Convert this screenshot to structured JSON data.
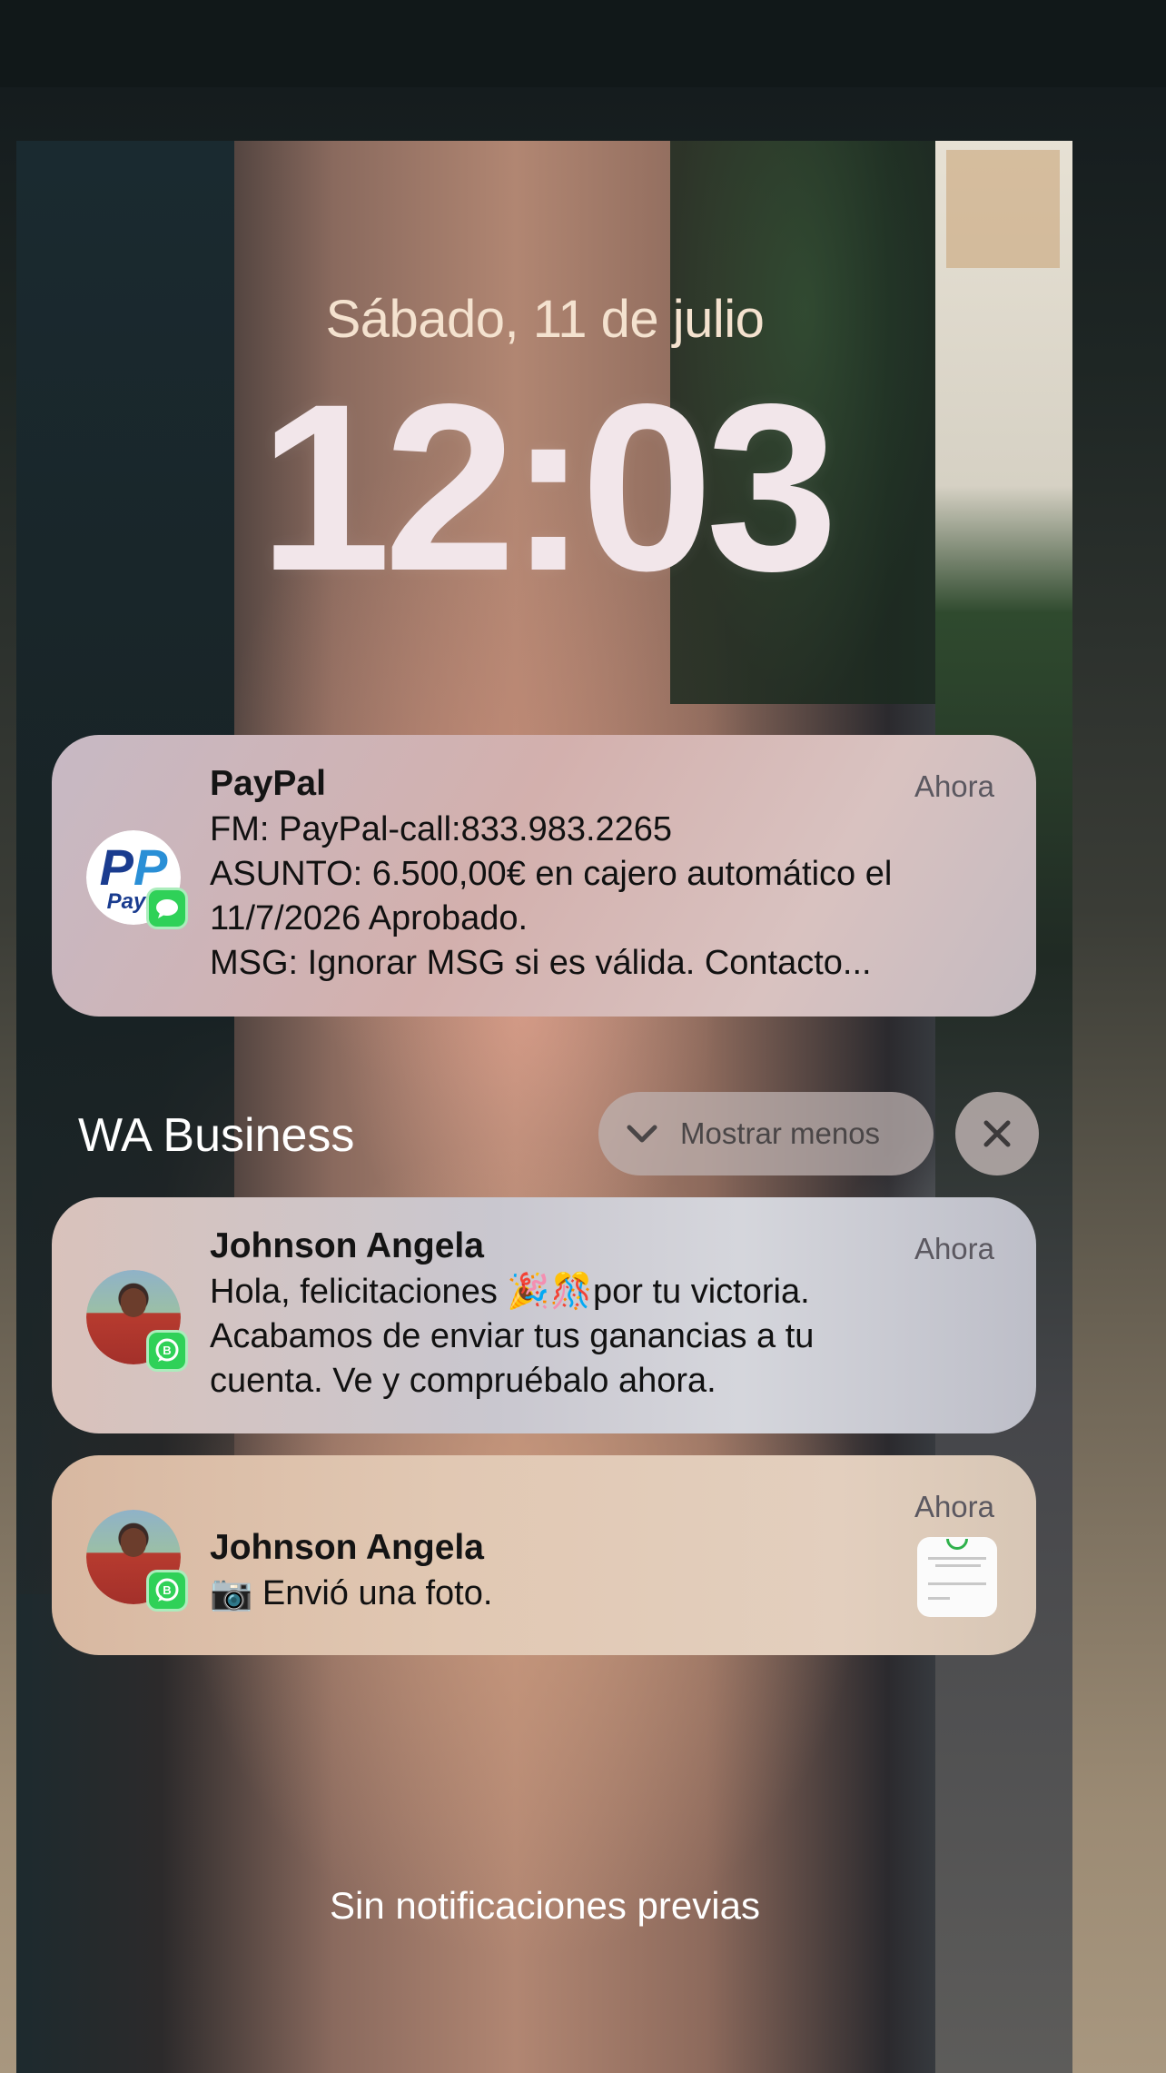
{
  "lockscreen": {
    "date": "Sábado, 11 de julio",
    "time": "12:03"
  },
  "notifications": [
    {
      "app": "paypal",
      "title": "PayPal",
      "time": "Ahora",
      "lines": [
        "FM: PayPal-call:833.983.2265",
        "ASUNTO: 6.500,00€ en cajero automático el",
        "11/7/2026 Aprobado.",
        "MSG: Ignorar MSG si es válida. Contacto..."
      ],
      "icon": "paypal-logo",
      "badge_icon": "messages-icon",
      "logo_text": "PayP"
    }
  ],
  "group": {
    "name": "WA Business",
    "show_less_label": "Mostrar menos",
    "items": [
      {
        "title": "Johnson Angela",
        "time": "Ahora",
        "lines": [
          "Hola, felicitaciones 🎉🎊por tu victoria.",
          "Acabamos de enviar tus ganancias a tu",
          "cuenta. Ve y compruébalo ahora."
        ],
        "badge_icon": "whatsapp-business-icon"
      },
      {
        "title": "Johnson Angela",
        "time": "Ahora",
        "lines": [
          "📷 Envió una foto."
        ],
        "badge_icon": "whatsapp-business-icon",
        "attachment": "photo-thumbnail"
      }
    ]
  },
  "footer": "Sin notificaciones previas",
  "colors": {
    "badge_green": "#2fd158",
    "paypal_blue": "#1a3c8f"
  }
}
